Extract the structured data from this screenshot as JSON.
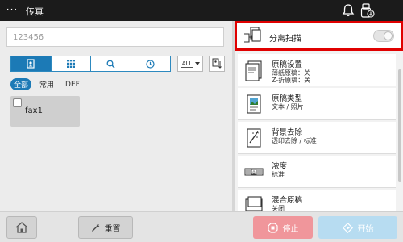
{
  "app": {
    "menu_label": "···",
    "title": "传真"
  },
  "address": {
    "value": "123456"
  },
  "tabs": [
    {
      "name": "address-book"
    },
    {
      "name": "keypad"
    },
    {
      "name": "search"
    },
    {
      "name": "history"
    }
  ],
  "filter_dropdown": {
    "label": "ALL"
  },
  "filters": [
    "全部",
    "常用",
    "DEF"
  ],
  "destination": {
    "name": "fax1"
  },
  "split_scan": {
    "label": "分离扫描"
  },
  "settings": [
    {
      "title": "原稿设置",
      "line1": "薄纸原稿：关",
      "line2": "Z-折原稿：关"
    },
    {
      "title": "原稿类型",
      "line1": "文本 / 照片",
      "line2": ""
    },
    {
      "title": "背景去除",
      "line1": "透印去除 / 标准",
      "line2": ""
    },
    {
      "title": "浓度",
      "line1": "标准",
      "line2": ""
    },
    {
      "title": "混合原稿",
      "line1": "关闭",
      "line2": ""
    }
  ],
  "bottom": {
    "reset_label": "重置",
    "stop_label": "停止",
    "start_label": "开始"
  },
  "colors": {
    "accent": "#1c7ab6",
    "highlight": "#e00000",
    "stop": "#f0969b",
    "start": "#b7dcf1"
  },
  "icons": [
    "bell-icon",
    "usb-icon",
    "split-scan-icon",
    "home-icon",
    "reset-icon",
    "stop-icon",
    "start-icon"
  ]
}
